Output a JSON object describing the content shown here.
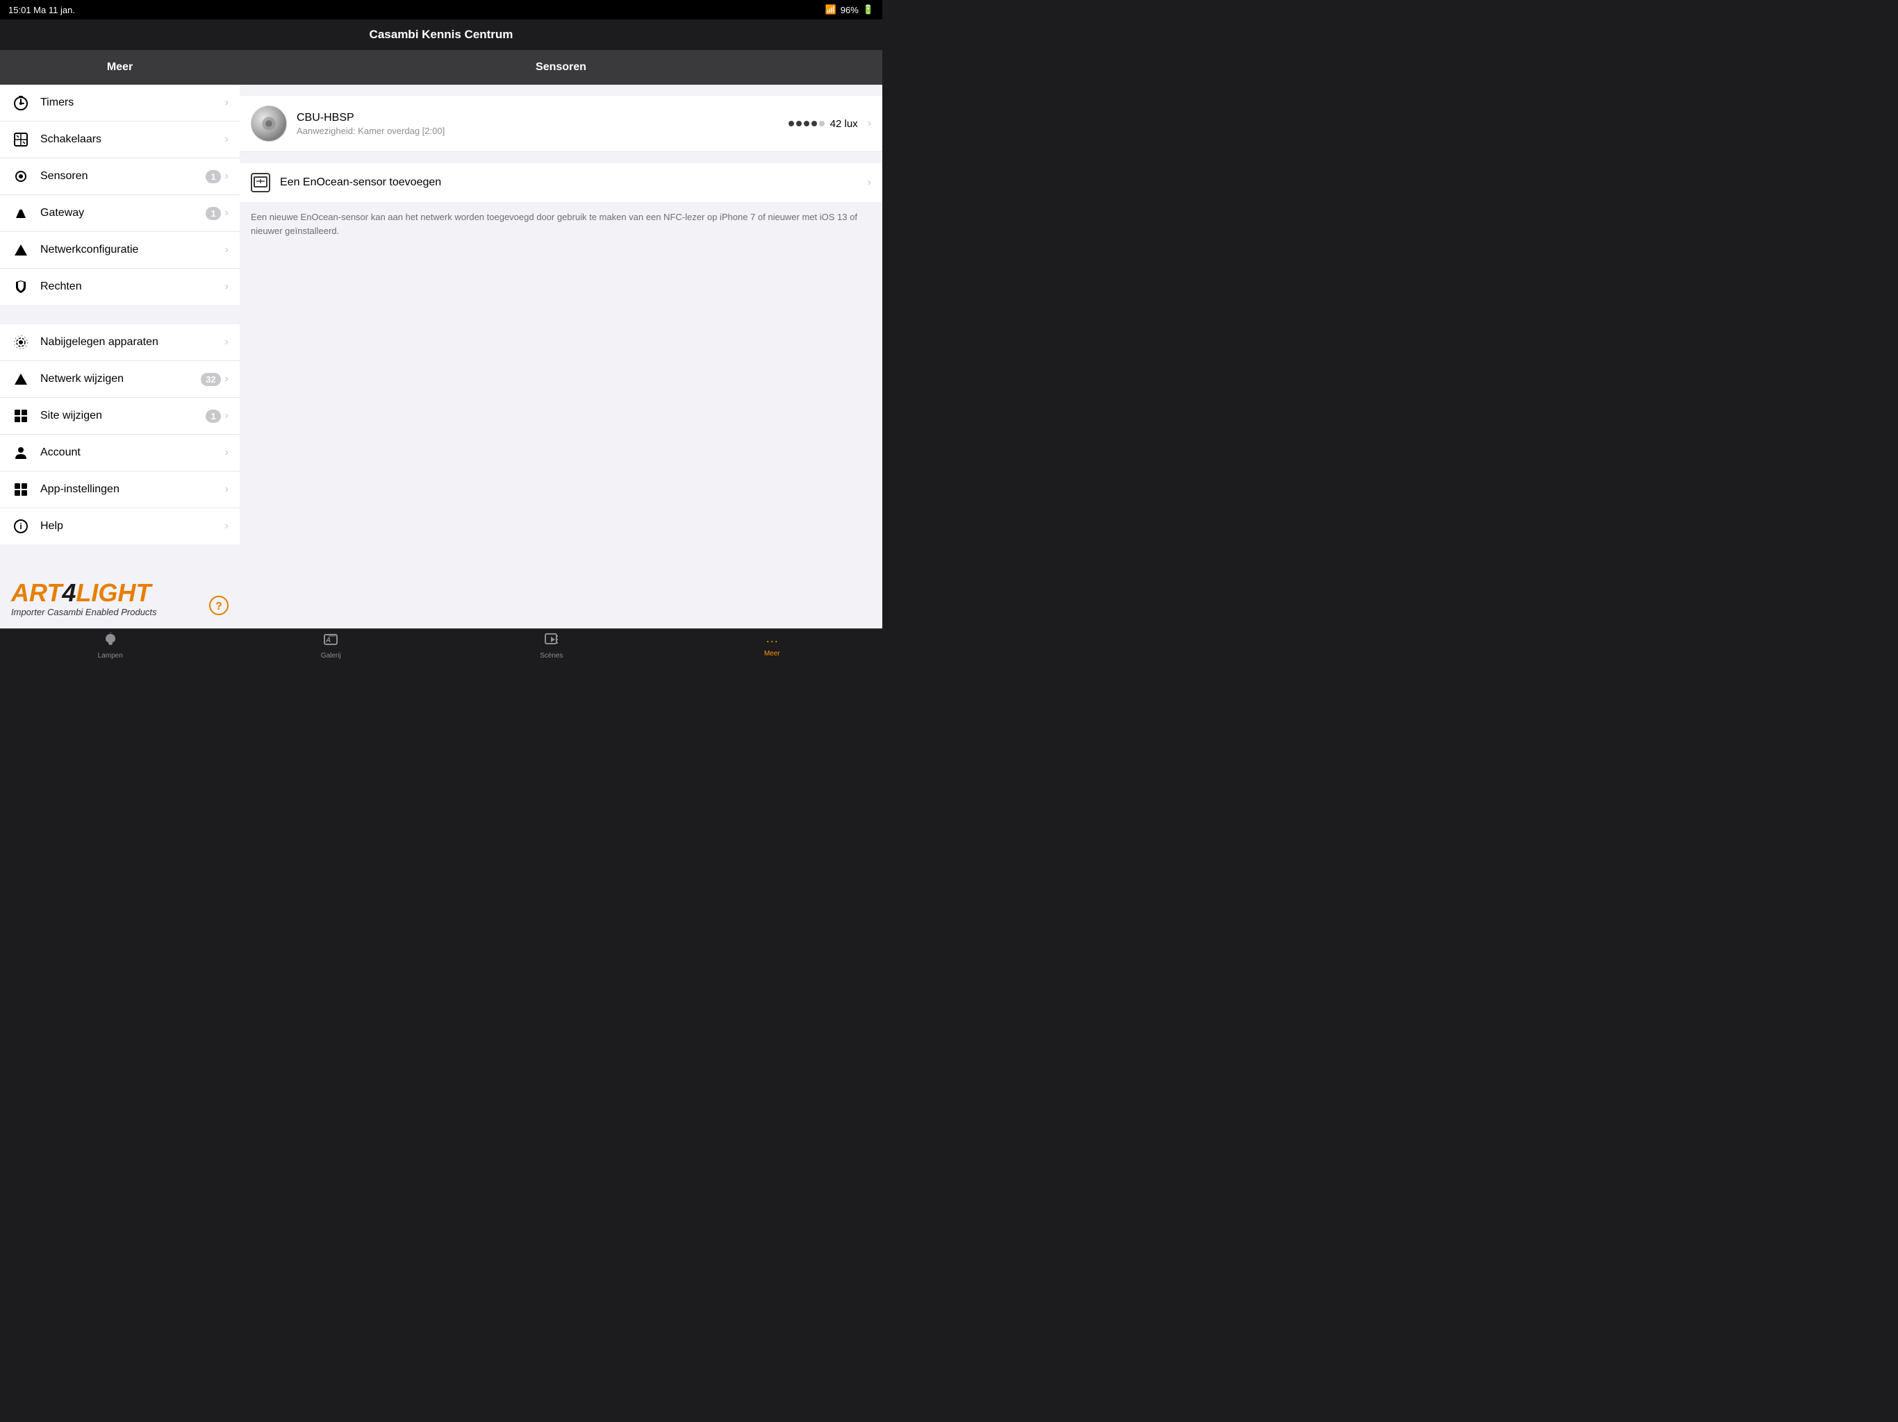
{
  "status_bar": {
    "time": "15:01",
    "day": "Ma 11 jan.",
    "battery": "96%",
    "wifi_icon": "wifi"
  },
  "title_bar": {
    "title": "Casambi Kennis Centrum"
  },
  "sidebar": {
    "header": "Meer",
    "items_section1": [
      {
        "id": "timers",
        "label": "Timers",
        "icon": "⏱",
        "badge": null
      },
      {
        "id": "schakelaars",
        "label": "Schakelaars",
        "icon": "⊠",
        "badge": null
      },
      {
        "id": "sensoren",
        "label": "Sensoren",
        "icon": "◎",
        "badge": "1"
      },
      {
        "id": "gateway",
        "label": "Gateway",
        "icon": "⬆",
        "badge": "1"
      },
      {
        "id": "netwerkconfiguratie",
        "label": "Netwerkconfiguratie",
        "icon": "▲",
        "badge": null
      },
      {
        "id": "rechten",
        "label": "Rechten",
        "icon": "◫",
        "badge": null
      }
    ],
    "items_section2": [
      {
        "id": "nabijgelegen",
        "label": "Nabijgelegen apparaten",
        "icon": "◎",
        "badge": null
      },
      {
        "id": "netwerk-wijzigen",
        "label": "Netwerk wijzigen",
        "icon": "▲",
        "badge": "32"
      },
      {
        "id": "site-wijzigen",
        "label": "Site wijzigen",
        "icon": "⊞",
        "badge": "1"
      },
      {
        "id": "account",
        "label": "Account",
        "icon": "👤",
        "badge": null
      },
      {
        "id": "app-instellingen",
        "label": "App-instellingen",
        "icon": "⊞",
        "badge": null
      },
      {
        "id": "help",
        "label": "Help",
        "icon": "ⓘ",
        "badge": null
      }
    ]
  },
  "content": {
    "header": "Sensoren",
    "sensor": {
      "name": "CBU-HBSP",
      "subtitle": "Aanwezigheid: Kamer overdag [2:00]",
      "lux": "42 lux",
      "signal_dots": 4,
      "signal_total": 5
    },
    "enocean": {
      "label": "Een EnOcean-sensor toevoegen",
      "description": "Een nieuwe EnOcean-sensor kan aan het netwerk worden toegevoegd door gebruik te maken van een NFC-lezer op iPhone 7 of nieuwer met iOS 13 of nieuwer geïnstalleerd."
    }
  },
  "tab_bar": {
    "items": [
      {
        "id": "lampen",
        "label": "Lampen",
        "icon": "🔦",
        "active": false
      },
      {
        "id": "galerij",
        "label": "Galerij",
        "icon": "🖼",
        "active": false
      },
      {
        "id": "scenes",
        "label": "Scènes",
        "icon": "▶",
        "active": false
      },
      {
        "id": "meer",
        "label": "Meer",
        "icon": "•••",
        "active": true
      }
    ]
  },
  "logo": {
    "brand": "ART4LIGHT",
    "subtitle": "Importer Casambi Enabled Products"
  }
}
